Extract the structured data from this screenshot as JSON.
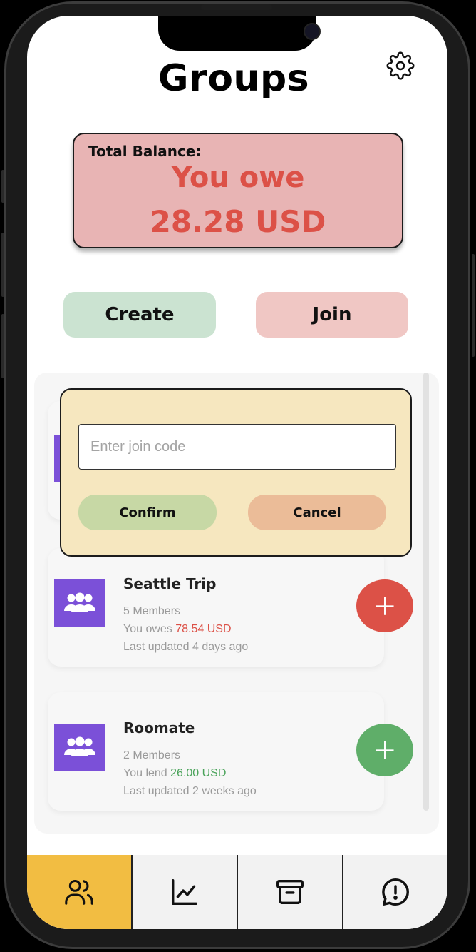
{
  "page": {
    "title": "Groups"
  },
  "icons": {
    "settings": "gear-icon",
    "group_avatar": "people-icon",
    "nav": [
      "groups-icon",
      "chart-line-icon",
      "archive-icon",
      "alert-chat-icon"
    ]
  },
  "balance": {
    "label": "Total Balance:",
    "status": "You owe",
    "amount": "28.28 USD"
  },
  "actions": {
    "create": "Create",
    "join": "Join"
  },
  "join_modal": {
    "placeholder": "Enter join code",
    "value": "",
    "confirm": "Confirm",
    "cancel": "Cancel"
  },
  "groups": [
    {
      "name": "Seattle Trip",
      "members": "5 Members",
      "balance_prefix": "You owes ",
      "balance_amount": "78.54 USD",
      "updated": "Last updated 4 days ago",
      "status": "owe"
    },
    {
      "name": "Roomate",
      "members": "2 Members",
      "balance_prefix": "You lend ",
      "balance_amount": "26.00 USD",
      "updated": "Last updated 2 weeks ago",
      "status": "lend"
    }
  ],
  "nav": {
    "active_index": 0
  },
  "colors": {
    "owe": "#dc5147",
    "lend": "#4aa35a",
    "accent_nav": "#f2bd42",
    "avatar": "#7b50d8",
    "modal_bg": "#f6e7bf",
    "balance_card": "#e8b4b4"
  }
}
